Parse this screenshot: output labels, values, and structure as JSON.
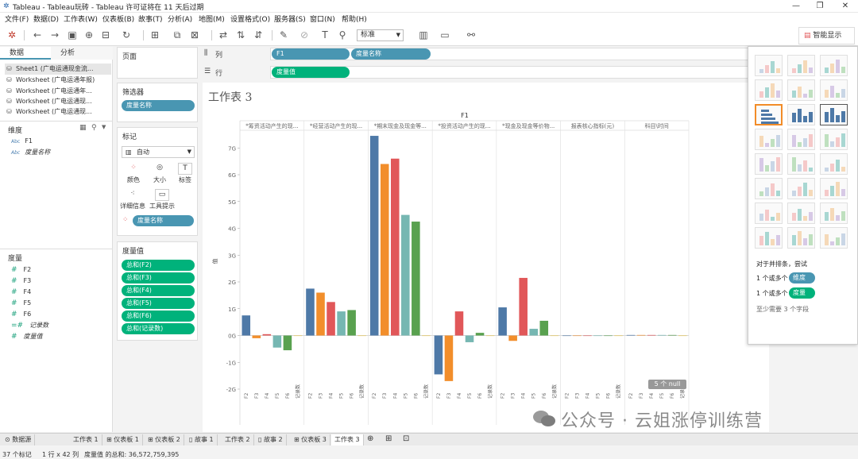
{
  "window": {
    "title": "Tableau - Tableau玩砖 - Tableau 许可证将在 11 天后过期"
  },
  "menu": [
    "文件(F)",
    "数据(D)",
    "工作表(W)",
    "仪表板(B)",
    "故事(T)",
    "分析(A)",
    "地图(M)",
    "设置格式(O)",
    "服务器(S)",
    "窗口(N)",
    "帮助(H)"
  ],
  "toolbar": {
    "fit": "标准",
    "show_me": "智能显示"
  },
  "left_pane": {
    "tabs": [
      "数据",
      "分析"
    ],
    "sources": [
      "Sheet1 (广电运通现金流...",
      "Worksheet (广电运通年报)",
      "Worksheet (广电运通年...",
      "Worksheet (广电运通现...",
      "Worksheet (广电运通现..."
    ],
    "dimensions_header": "维度",
    "dimensions": [
      "F1",
      "度量名称"
    ],
    "measures_header": "度量",
    "measures": [
      "F2",
      "F3",
      "F4",
      "F5",
      "F6",
      "记录数",
      "度量值"
    ]
  },
  "cards": {
    "pages": "页面",
    "filters": "筛选器",
    "filter_pill": "度量名称",
    "marks": "标记",
    "marks_type": "自动",
    "mark_buttons": [
      "颜色",
      "大小",
      "标签",
      "详细信息",
      "工具提示"
    ],
    "color_pill": "度量名称",
    "measure_values": "度量值",
    "mv_pills": [
      "总和(F2)",
      "总和(F3)",
      "总和(F4)",
      "总和(F5)",
      "总和(F6)",
      "总和(记录数)"
    ]
  },
  "shelves": {
    "columns_label": "列",
    "rows_label": "行",
    "col_pills": [
      "F1",
      "度量名称"
    ],
    "row_pill": "度量值"
  },
  "viz": {
    "title": "工作表 3",
    "null_badge": "5 个 null"
  },
  "chart_data": {
    "type": "bar",
    "title": "F1",
    "ylabel": "值",
    "y_ticks": [
      "-2G",
      "-1G",
      "0G",
      "1G",
      "2G",
      "3G",
      "4G",
      "5G",
      "6G",
      "7G"
    ],
    "ylim": [
      -2,
      7.6
    ],
    "panes": [
      "*筹资活动产生的现...",
      "*经营活动产生的现...",
      "*期末现金及现金等...",
      "*投资活动产生的现...",
      "*现金及现金等价物...",
      "报表核心指标(元)",
      "科目\\时间"
    ],
    "categories": [
      "F2",
      "F3",
      "F4",
      "F5",
      "F6",
      "记录数"
    ],
    "series_colors": [
      "#4e79a7",
      "#f28e2b",
      "#e15759",
      "#76b7b2",
      "#59a14f",
      "#edc948"
    ],
    "values": [
      [
        0.75,
        -0.1,
        0.05,
        -0.45,
        -0.55,
        0
      ],
      [
        1.75,
        1.6,
        1.25,
        0.9,
        0.95,
        0
      ],
      [
        7.45,
        6.4,
        6.6,
        4.5,
        4.25,
        0
      ],
      [
        -1.45,
        -1.7,
        0.9,
        -0.25,
        0.1,
        0
      ],
      [
        1.05,
        -0.2,
        2.15,
        0.25,
        0.55,
        0
      ],
      [
        0,
        0,
        0,
        0,
        0,
        0
      ],
      [
        0.02,
        0.02,
        0.02,
        0.02,
        0.02,
        0
      ]
    ]
  },
  "show_me": {
    "hint_title": "对于并排条，尝试",
    "hint_line1_prefix": "1 个或多个",
    "hint_dim": "维度",
    "hint_line2_prefix": "1 个或多个",
    "hint_measure": "度量",
    "hint_line3": "至少需要 3 个字段"
  },
  "bottom_tabs": [
    "数据源",
    "工作表 1",
    "仪表板 1",
    "仪表板 2",
    "故事 1",
    "工作表 2",
    "故事 2",
    "仪表板 3",
    "工作表 3"
  ],
  "status": {
    "marks": "37 个标记",
    "rows": "1 行 x 42 列",
    "sum": "度量值 的总和: 36,572,759,395"
  },
  "watermark": "公众号 · 云姐涨停训练营"
}
